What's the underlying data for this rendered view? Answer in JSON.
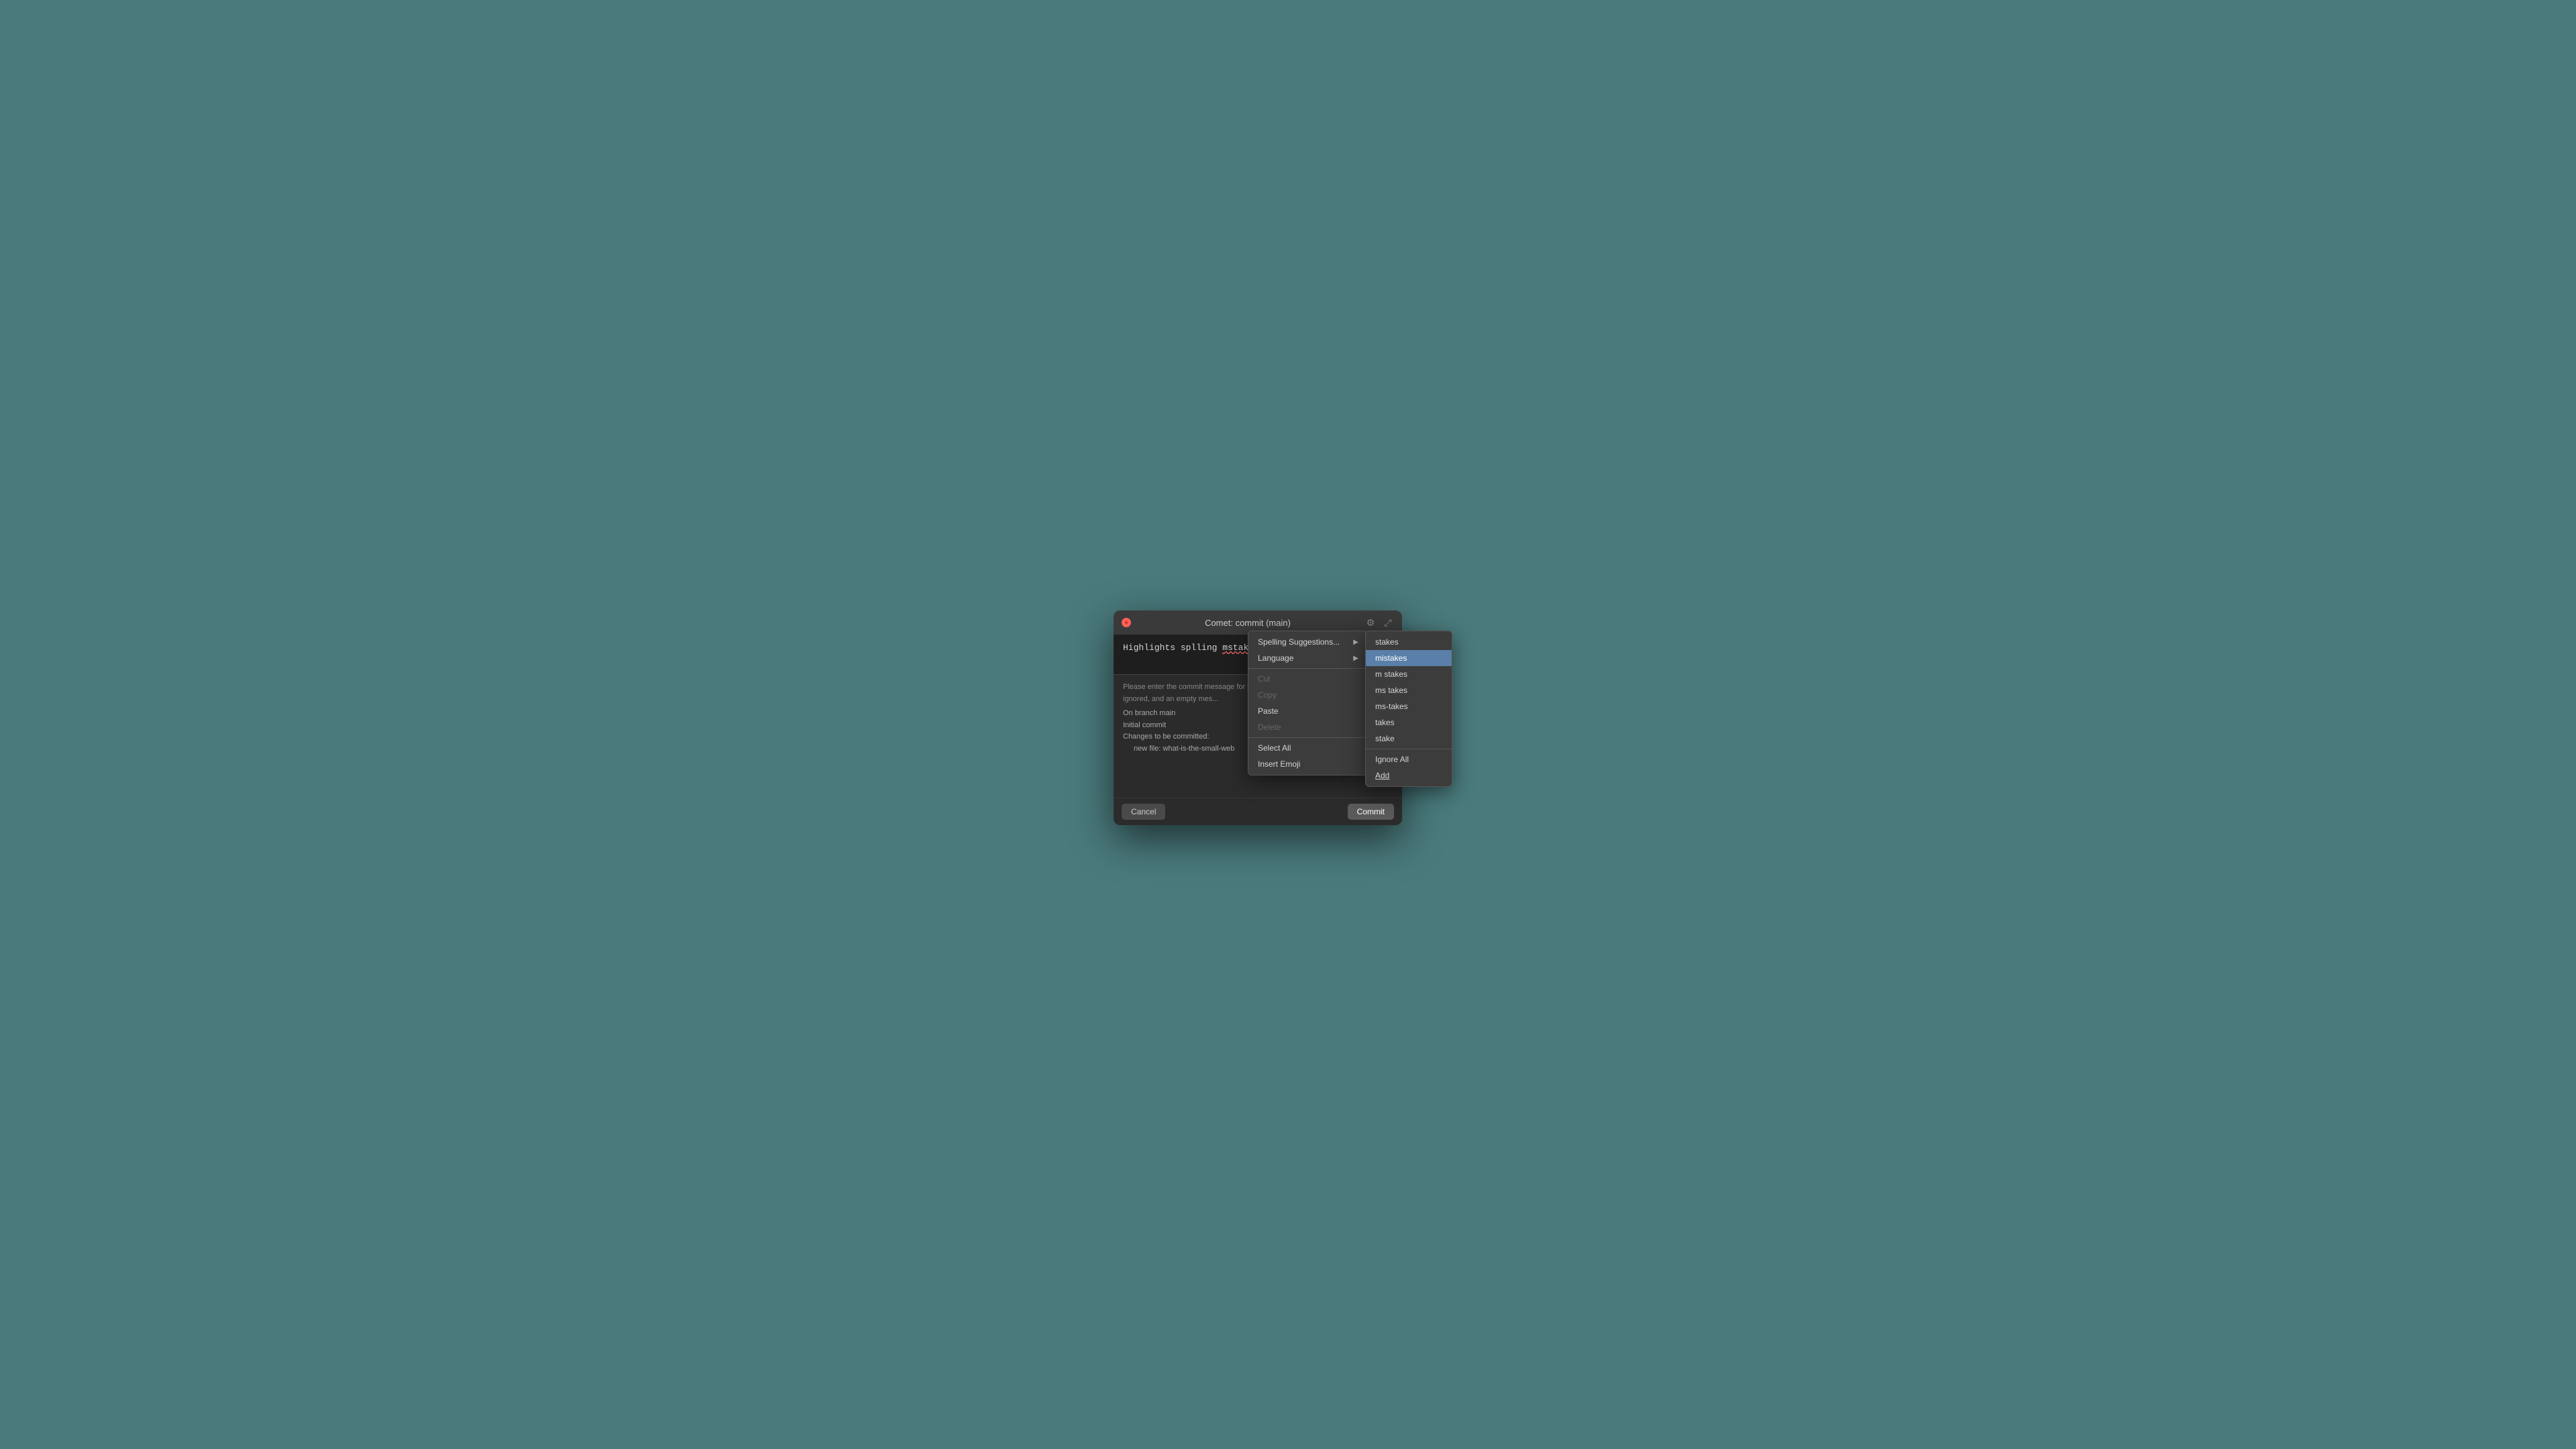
{
  "background": "#4a7a7c",
  "dialog": {
    "title": "Comet: commit (main)",
    "close_label": "×",
    "gear_icon": "⚙",
    "expand_icon": "⤢",
    "commit_message": "Highlights splling mstakes",
    "misspelled_words": [
      "splling",
      "mstakes"
    ],
    "info_text": "Please enter the commit message for your changes. Lines starting with '#' will be ignored, and an empty mes...",
    "branch_line": "On branch main",
    "initial_commit_line": "Initial commit",
    "changes_line": "Changes to be committed:",
    "file_line": "new file:   what-is-the-small-web",
    "cancel_label": "Cancel",
    "commit_label": "Commit"
  },
  "context_menu": {
    "spelling_suggestions_label": "Spelling Suggestions...",
    "language_label": "Language",
    "cut_label": "Cut",
    "copy_label": "Copy",
    "paste_label": "Paste",
    "delete_label": "Delete",
    "select_all_label": "Select All",
    "insert_emoji_label": "Insert Emoji",
    "spelling_items": [
      {
        "label": "stakes",
        "highlighted": false,
        "underline": false
      },
      {
        "label": "mistakes",
        "highlighted": true,
        "underline": false
      },
      {
        "label": "m stakes",
        "highlighted": false,
        "underline": false
      },
      {
        "label": "ms takes",
        "highlighted": false,
        "underline": false
      },
      {
        "label": "ms-takes",
        "highlighted": false,
        "underline": false
      },
      {
        "label": "takes",
        "highlighted": false,
        "underline": false
      },
      {
        "label": "stake",
        "highlighted": false,
        "underline": false
      },
      {
        "label": "Ignore All",
        "highlighted": false,
        "underline": false
      },
      {
        "label": "Add",
        "highlighted": false,
        "underline": true
      }
    ]
  }
}
